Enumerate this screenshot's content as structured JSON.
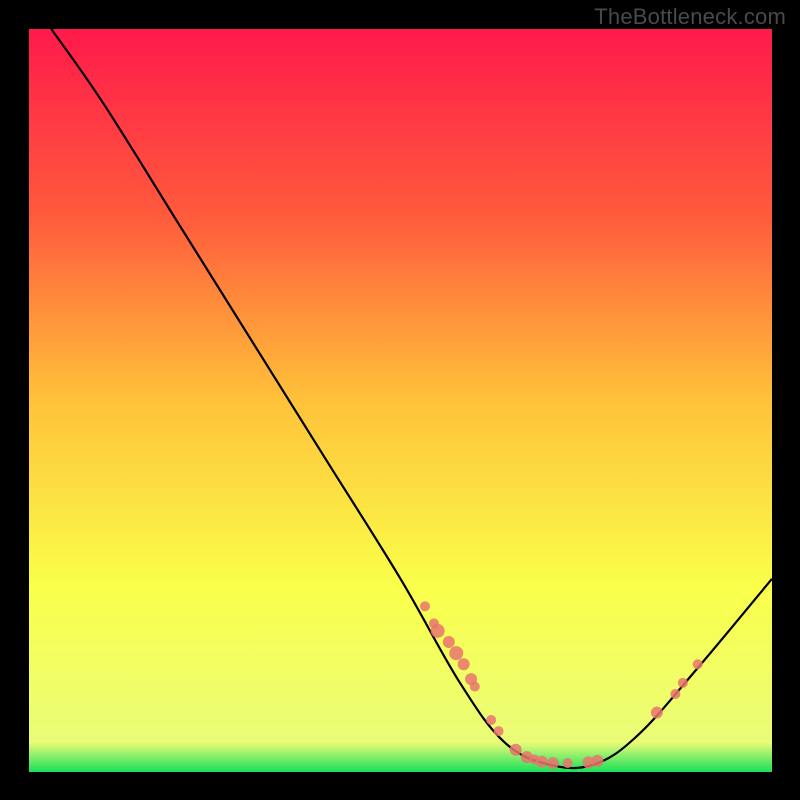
{
  "watermark": "TheBottleneck.com",
  "chart_data": {
    "type": "line",
    "title": "",
    "xlabel": "",
    "ylabel": "",
    "xlim": [
      0,
      100
    ],
    "ylim": [
      0,
      100
    ],
    "background_gradient": {
      "stops": [
        {
          "offset": 0,
          "color": "#ff1a4b"
        },
        {
          "offset": 25,
          "color": "#ff5a3c"
        },
        {
          "offset": 50,
          "color": "#ffc23a"
        },
        {
          "offset": 75,
          "color": "#faff4a"
        },
        {
          "offset": 96,
          "color": "#eafc78"
        },
        {
          "offset": 100,
          "color": "#18e05a"
        }
      ]
    },
    "curve": [
      {
        "x": 3,
        "y": 100
      },
      {
        "x": 10,
        "y": 90
      },
      {
        "x": 20,
        "y": 74
      },
      {
        "x": 30,
        "y": 58
      },
      {
        "x": 40,
        "y": 42
      },
      {
        "x": 50,
        "y": 26
      },
      {
        "x": 58,
        "y": 12
      },
      {
        "x": 64,
        "y": 4
      },
      {
        "x": 70,
        "y": 1
      },
      {
        "x": 76,
        "y": 1
      },
      {
        "x": 82,
        "y": 5
      },
      {
        "x": 90,
        "y": 14
      },
      {
        "x": 100,
        "y": 26
      }
    ],
    "points": [
      {
        "x": 53.3,
        "y": 22.3,
        "r": 5
      },
      {
        "x": 54.5,
        "y": 20.0,
        "r": 5
      },
      {
        "x": 55.0,
        "y": 19.0,
        "r": 7
      },
      {
        "x": 56.5,
        "y": 17.5,
        "r": 6
      },
      {
        "x": 57.5,
        "y": 16.0,
        "r": 7
      },
      {
        "x": 58.5,
        "y": 14.5,
        "r": 6
      },
      {
        "x": 59.5,
        "y": 12.5,
        "r": 6
      },
      {
        "x": 60.0,
        "y": 11.5,
        "r": 5
      },
      {
        "x": 62.2,
        "y": 7.0,
        "r": 5
      },
      {
        "x": 63.2,
        "y": 5.5,
        "r": 5
      },
      {
        "x": 65.5,
        "y": 3.0,
        "r": 6
      },
      {
        "x": 67.0,
        "y": 2.0,
        "r": 6
      },
      {
        "x": 68.0,
        "y": 1.7,
        "r": 5
      },
      {
        "x": 69.0,
        "y": 1.4,
        "r": 6
      },
      {
        "x": 70.5,
        "y": 1.2,
        "r": 6
      },
      {
        "x": 72.5,
        "y": 1.2,
        "r": 5
      },
      {
        "x": 75.3,
        "y": 1.3,
        "r": 6
      },
      {
        "x": 76.5,
        "y": 1.5,
        "r": 6
      },
      {
        "x": 84.5,
        "y": 8.0,
        "r": 6
      },
      {
        "x": 87.0,
        "y": 10.5,
        "r": 5
      },
      {
        "x": 88.0,
        "y": 12.0,
        "r": 5
      },
      {
        "x": 90.0,
        "y": 14.5,
        "r": 5
      }
    ]
  }
}
